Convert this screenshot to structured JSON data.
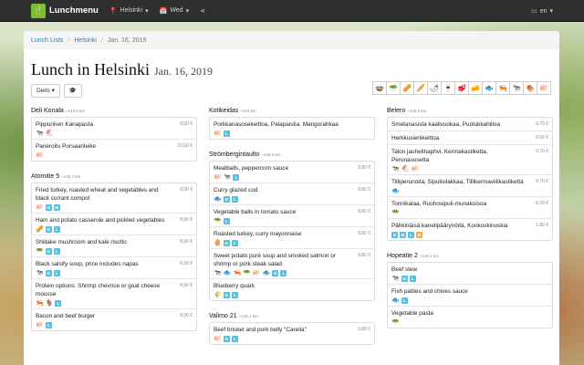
{
  "navbar": {
    "brand": "Lunchmenu",
    "city": "Helsinki",
    "day": "Wed",
    "language": "en"
  },
  "breadcrumb": [
    "Lunch Lists",
    "Helsinki",
    "Jan. 16, 2019"
  ],
  "title": {
    "main": "Lunch in Helsinki",
    "date": "Jan. 16, 2019"
  },
  "toolbar": {
    "diets_label": "Diets"
  },
  "filter_icons": [
    "🍲",
    "🥗",
    "🥜",
    "🥖",
    "🌶",
    "🍷",
    "🥩",
    "🧀",
    "🐟",
    "🦐",
    "🐄",
    "🍖",
    "🐖"
  ],
  "colors": {
    "diet_badge": "#5bc0de",
    "orange_badge": "#f0ad4e",
    "brand": "#7bbf2a",
    "navbar": "#2f2f2f"
  },
  "columns": [
    [
      {
        "name": "Deli Konala",
        "dist": "~143.6 km",
        "dishes": [
          {
            "name": "Pippurinen Kanapasta",
            "price": "8,50 €",
            "icons": [
              "🐄",
              "🐔"
            ],
            "diets": []
          },
          {
            "name": "Paneroitu Porsaanleike",
            "price": "10,50 €",
            "icons": [
              "🐖"
            ],
            "diets": []
          }
        ]
      },
      {
        "name": "Atomitie 5",
        "dist": "~145.7 km",
        "dishes": [
          {
            "name": "Fried turkey, roasted wheat and vegetables and black currant compot",
            "price": "8,90 €",
            "icons": [
              "🐖"
            ],
            "diets": [
              "G",
              "M"
            ]
          },
          {
            "name": "Ham and potato casserole and pickled vegetables",
            "price": "8,90 €",
            "icons": [
              "🥜"
            ],
            "diets": [
              "G",
              "L"
            ]
          },
          {
            "name": "Shiitake mushroom and kale risotto",
            "price": "8,90 €",
            "icons": [
              "🥗"
            ],
            "diets": [
              "G",
              "L"
            ]
          },
          {
            "name": "Black salsify soup, price includes napas",
            "price": "6,50 €",
            "icons": [
              "🐄"
            ],
            "diets": [
              "G",
              "L"
            ]
          },
          {
            "name": "Protein options: Shrimp chevrice or goat cheese mousse",
            "price": "8,90 €",
            "icons": [
              "🦐",
              "🐐"
            ],
            "diets": [
              "L"
            ]
          },
          {
            "name": "Bacon and beef burger",
            "price": "8,90 €",
            "icons": [
              "🐖"
            ],
            "diets": [
              "L"
            ]
          }
        ]
      }
    ],
    [
      {
        "name": "Kotikeidas",
        "dist": "~144 km",
        "dishes": [
          {
            "name": "Porkkanasosekeittoa, Palapaistia, Mangorahkaa",
            "price": "",
            "icons": [
              "🐖"
            ],
            "diets": [
              "L"
            ]
          }
        ]
      },
      {
        "name": "Strömbergintaulto",
        "dist": "~145.6 km",
        "dishes": [
          {
            "name": "Meatballs, peppercorn sauce",
            "price": "9,80 €",
            "icons": [
              "🐖",
              "🐄"
            ],
            "diets": [
              "L"
            ]
          },
          {
            "name": "Curry glazed cod",
            "price": "9,80 €",
            "icons": [
              "🐟"
            ],
            "diets": [
              "G",
              "L"
            ]
          },
          {
            "name": "Vegetable balls in tomato sauce",
            "price": "9,80 €",
            "icons": [
              "🥗"
            ],
            "diets": [
              "L"
            ]
          },
          {
            "name": "Roasted turkey, curry mayonnaise",
            "price": "9,80 €",
            "icons": [
              "🥚"
            ],
            "diets": [
              "G",
              "L"
            ]
          },
          {
            "name": "Sweet potato puré soup and smoked salmon or shrimp or pork steak salad",
            "price": "9,80 €",
            "icons": [
              "🐄",
              "🐟",
              "🦐",
              "🥗",
              "🐖",
              "🐟"
            ],
            "diets": [
              "G",
              "L"
            ]
          },
          {
            "name": "Blueberry quark",
            "price": "",
            "icons": [
              "🌾"
            ],
            "diets": [
              "G",
              "L"
            ]
          }
        ]
      },
      {
        "name": "Valimo 21",
        "dist": "~146.1 km",
        "dishes": [
          {
            "name": "Beef brisket and pork belly \"Carelia\"",
            "price": "9,80 €",
            "icons": [
              "🐖"
            ],
            "diets": [
              "G",
              "L"
            ]
          }
        ]
      }
    ],
    [
      {
        "name": "Belero",
        "dist": "~145.5 km",
        "dishes": [
          {
            "name": "Smetanasista kaalivuokaa, Puolukkahilloa",
            "price": "9,70 €",
            "icons": [],
            "diets": []
          },
          {
            "name": "Herkkusienikeittoa",
            "price": "6,50 €",
            "icons": [],
            "diets": []
          },
          {
            "name": "Talon jauhelihaphvi, Kermakastiketta, Perunasosetta",
            "price": "9,70 €",
            "icons": [
              "🐄",
              "🐔",
              "🐖"
            ],
            "diets": []
          },
          {
            "name": "Tilliperunoita, Sipulisilakkaa, Tillikermaviilikastiketta",
            "price": "9,70 €",
            "icons": [
              "🐟"
            ],
            "diets": []
          },
          {
            "name": "Tonnikalaa, Ruohosipuli-munakoisoa",
            "price": "8,20 €",
            "icons": [
              "🥗"
            ],
            "diets": []
          },
          {
            "name": "Pähkinäisä kanelipäärynöitä, Kookoskinuskia",
            "price": "1,80 €",
            "icons": [],
            "diets": [
              "G",
              "M",
              "L",
              "N"
            ]
          }
        ]
      },
      {
        "name": "Hopeatie 2",
        "dist": "~146.1 km",
        "dishes": [
          {
            "name": "Beef stew",
            "price": "",
            "icons": [
              "🐄"
            ],
            "diets": [
              "G",
              "L"
            ]
          },
          {
            "name": "Fish patties and chives sauce",
            "price": "",
            "icons": [
              "🐟"
            ],
            "diets": [
              "L"
            ]
          },
          {
            "name": "Vegetable pasta",
            "price": "",
            "icons": [
              "🥗"
            ],
            "diets": []
          }
        ]
      }
    ]
  ]
}
